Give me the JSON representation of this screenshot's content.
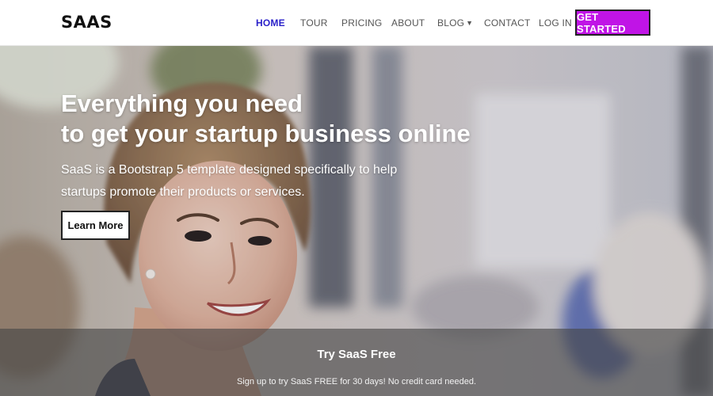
{
  "navbar": {
    "brand": "SAAS",
    "links": [
      {
        "label": "HOME",
        "active": true
      },
      {
        "label": "TOUR",
        "active": false
      },
      {
        "label": "PRICING",
        "active": false
      },
      {
        "label": "ABOUT",
        "active": false
      },
      {
        "label": "BLOG",
        "active": false,
        "icon": "chevron-down-icon"
      },
      {
        "label": "CONTACT",
        "active": false
      },
      {
        "label": "LOG IN",
        "active": false
      }
    ],
    "cta_label": "GET STARTED"
  },
  "hero": {
    "title_line1": "Everything you need",
    "title_line2": "to get your startup business online",
    "subtitle": "SaaS is a Bootstrap 5 template designed specifically to help startups promote their products or services.",
    "button_label": "Learn More"
  },
  "band": {
    "title": "Try SaaS Free",
    "text": "Sign up to try SaaS FREE for 30 days! No credit card needed."
  },
  "colors": {
    "accent": "#c014e6",
    "nav_active": "#2a21c9"
  }
}
